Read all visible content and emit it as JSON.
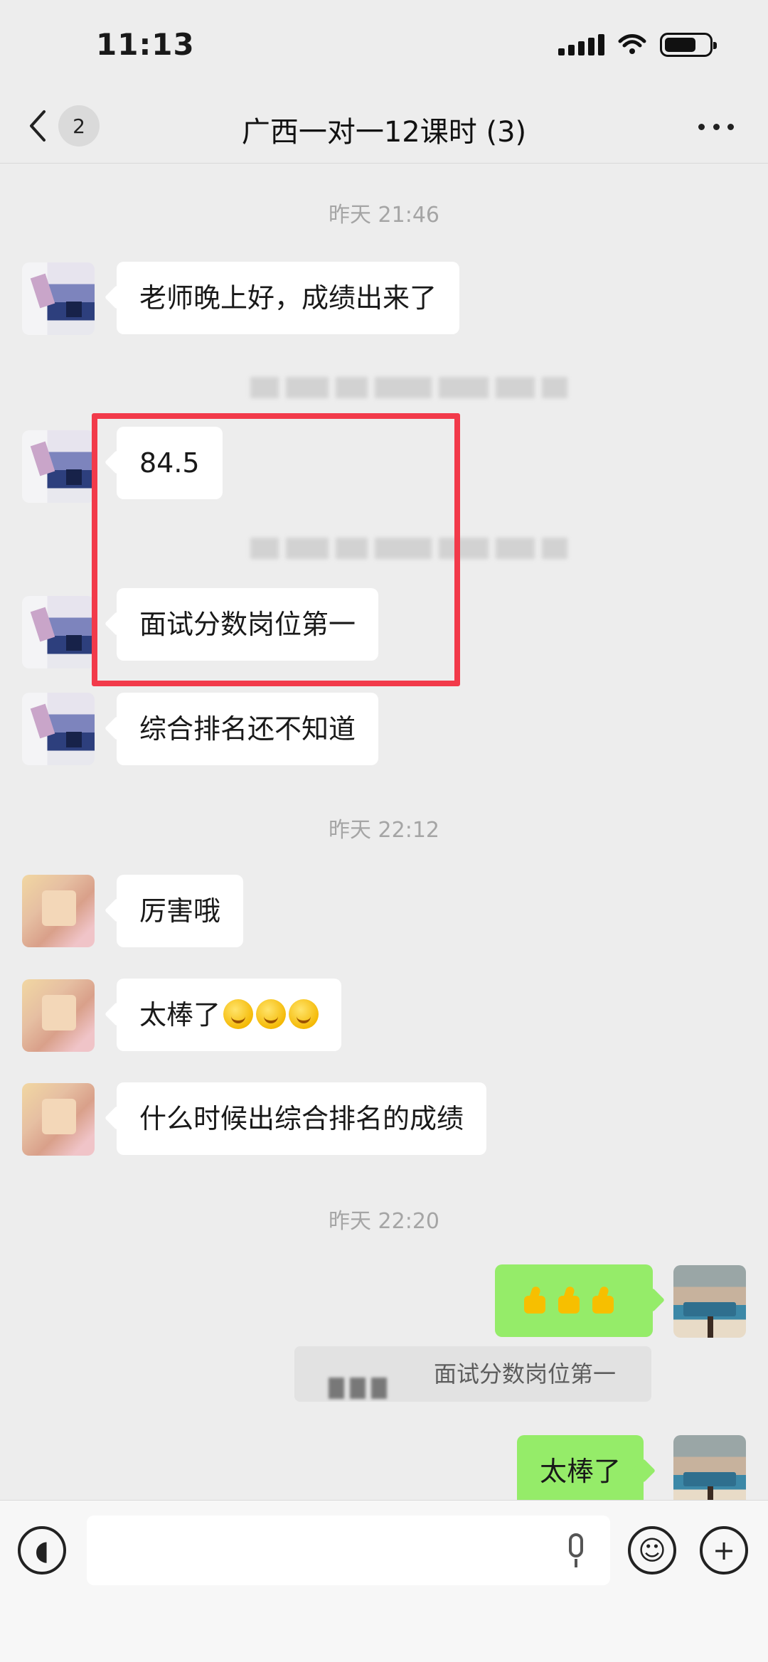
{
  "status_bar": {
    "time": "11:13"
  },
  "nav": {
    "back_count": "2",
    "title": "广西一对一12课时 (3)"
  },
  "messages": {
    "ts1": "昨天 21:46",
    "m1": "老师晚上好，成绩出来了",
    "m2": "84.5",
    "m3": "面试分数岗位第一",
    "m4": "综合排名还不知道",
    "ts2": "昨天 22:12",
    "m5": "厉害哦",
    "m6": "太棒了",
    "m7": "什么时候出综合排名的成绩",
    "ts3": "昨天 22:20",
    "quote": "面试分数岗位第一",
    "m8": "太棒了"
  },
  "colors": {
    "self_bubble": "#95ec69",
    "highlight": "#f23a4a",
    "background": "#ededed"
  },
  "icons": {
    "back": "chevron-left-icon",
    "more": "more-dots-icon",
    "voice": "voice-icon",
    "emoji": "emoji-icon",
    "add": "plus-icon",
    "mic": "microphone-icon"
  }
}
